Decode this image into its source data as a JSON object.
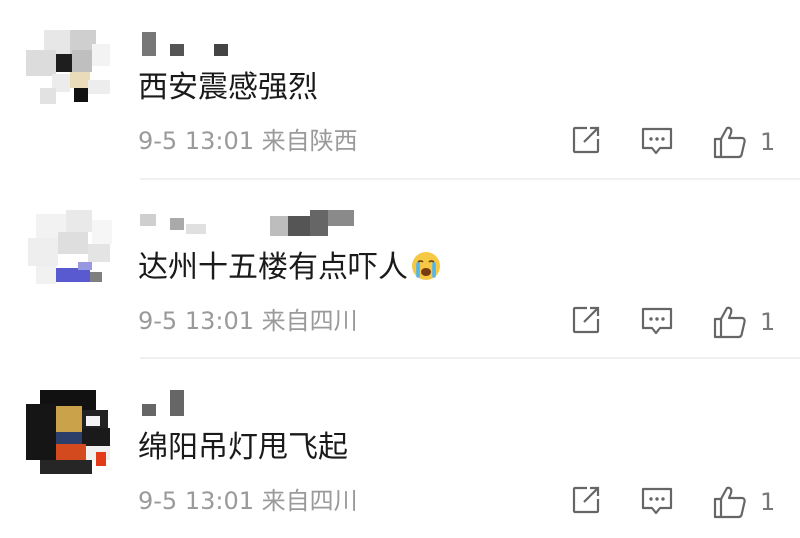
{
  "comments": [
    {
      "text": "西安震感强烈",
      "date": "9-5 13:01",
      "location": "来自陕西",
      "likes": "1",
      "has_emoji": false
    },
    {
      "text": "达州十五楼有点吓人",
      "date": "9-5 13:01",
      "location": "来自四川",
      "likes": "1",
      "has_emoji": true,
      "emoji": "crying-face-emoji"
    },
    {
      "text": "绵阳吊灯甩飞起",
      "date": "9-5 13:01",
      "location": "来自四川",
      "likes": "1",
      "has_emoji": false
    }
  ],
  "icons": {
    "share": "share-icon",
    "reply": "comment-icon",
    "like": "thumbs-up-icon"
  },
  "colors": {
    "text": "#1a1a1a",
    "meta": "#9a9a9a",
    "icon": "#666666",
    "divider": "#f0f0f0"
  }
}
